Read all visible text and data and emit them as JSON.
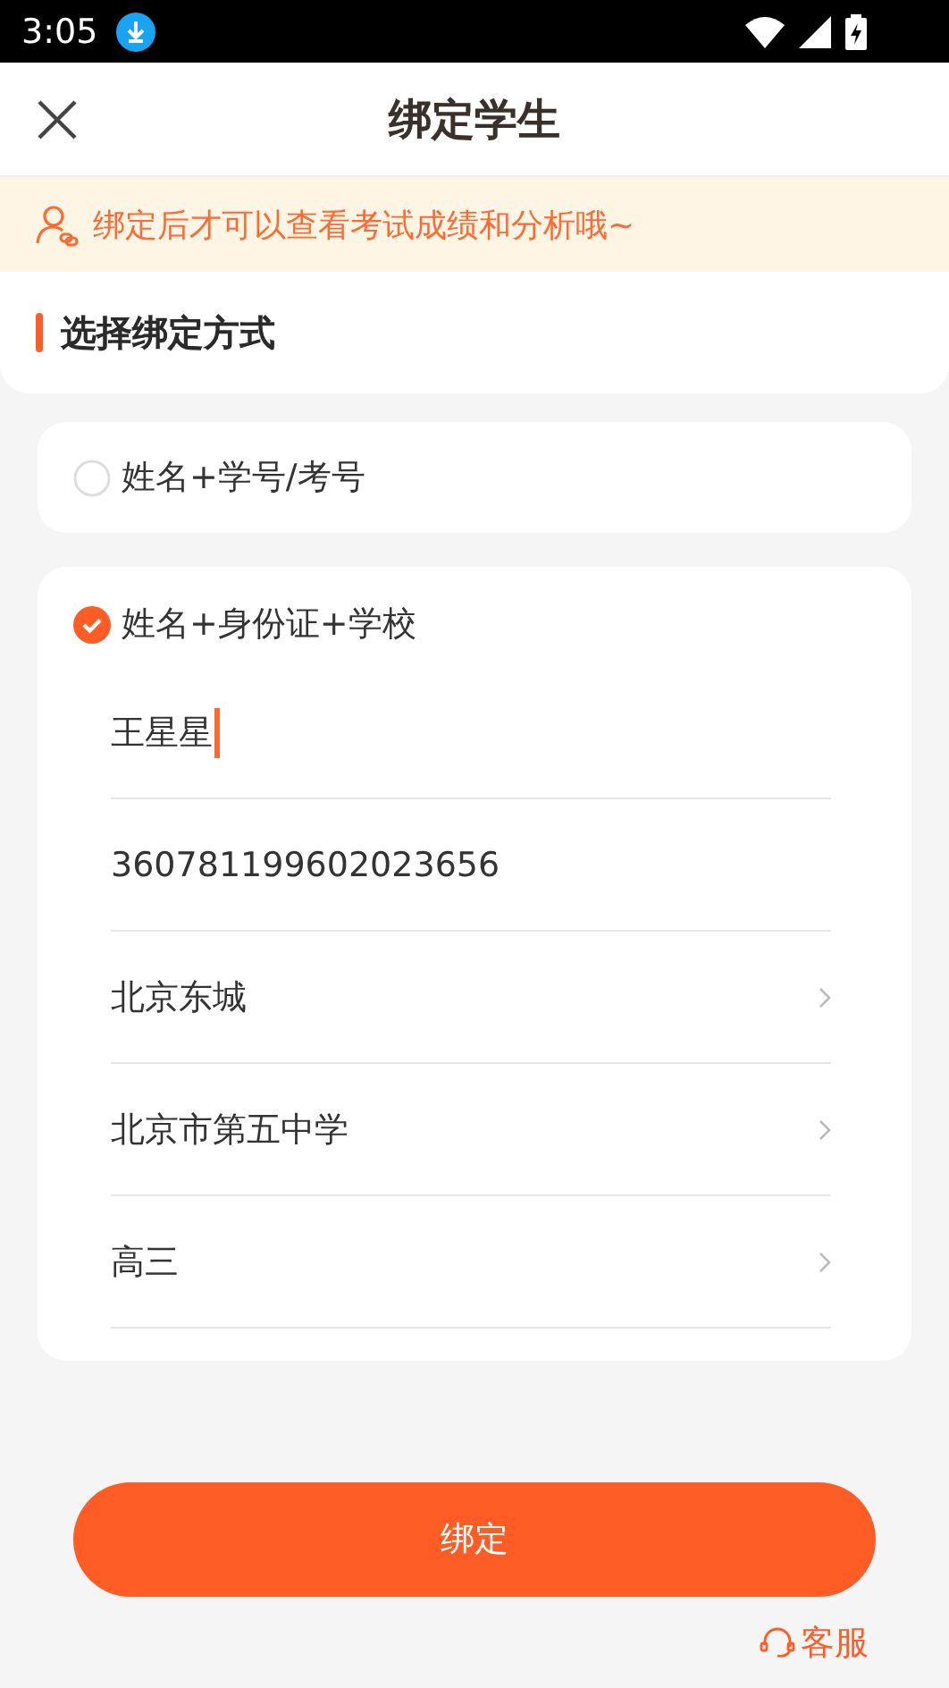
{
  "status_bar": {
    "time": "3:05"
  },
  "header": {
    "title": "绑定学生"
  },
  "notice": {
    "text": "绑定后才可以查看考试成绩和分析哦~"
  },
  "section": {
    "title": "选择绑定方式"
  },
  "options": [
    {
      "label": "姓名+学号/考号",
      "selected": false
    },
    {
      "label": "姓名+身份证+学校",
      "selected": true,
      "fields": [
        {
          "kind": "input",
          "value": "王星星",
          "focused": true
        },
        {
          "kind": "input",
          "value": "360781199602023656",
          "focused": false
        },
        {
          "kind": "select",
          "value": "北京东城",
          "focused": false
        },
        {
          "kind": "select",
          "value": "北京市第五中学",
          "focused": false
        },
        {
          "kind": "select",
          "value": "高三",
          "focused": false
        }
      ]
    }
  ],
  "bind_button": {
    "label": "绑定"
  },
  "support_link": {
    "label": "客服"
  }
}
